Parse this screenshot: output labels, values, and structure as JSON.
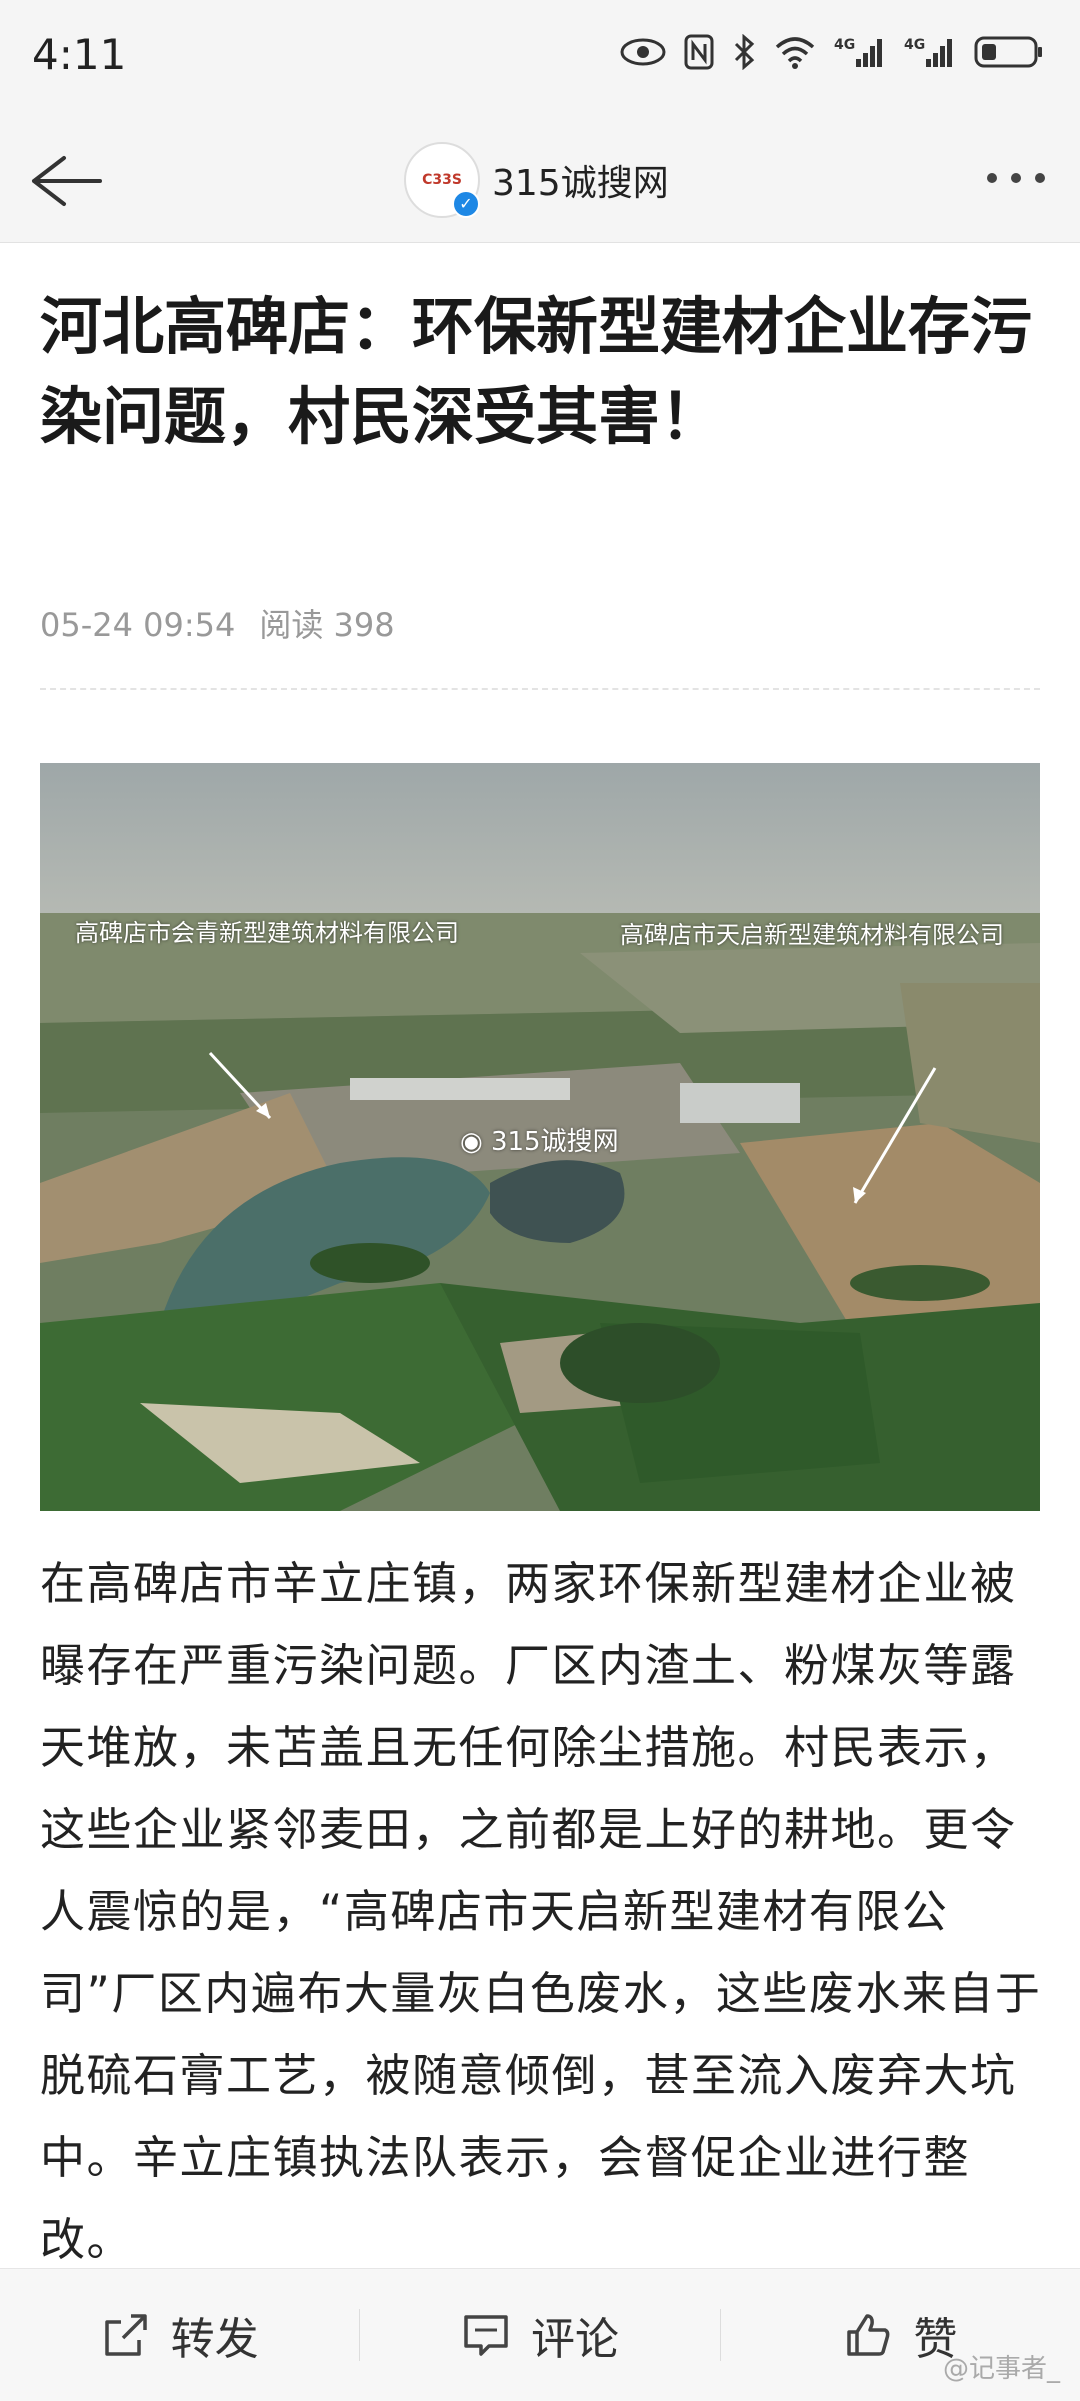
{
  "status_bar": {
    "time": "4:11"
  },
  "header": {
    "brand_logo_text": "C33S",
    "brand_name": "315诚搜网"
  },
  "article": {
    "title": "河北高碑店：环保新型建材企业存污染问题，村民深受其害！",
    "date": "05-24 09:54",
    "reads": "阅读 398",
    "photo": {
      "label_left": "高碑店市会青新型建筑材料有限公司",
      "label_right": "高碑店市天启新型建筑材料有限公司",
      "watermark": "315诚搜网"
    },
    "body": "在高碑店市辛立庄镇，两家环保新型建材企业被曝存在严重污染问题。厂区内渣土、粉煤灰等露天堆放，未苫盖且无任何除尘措施。村民表示，这些企业紧邻麦田，之前都是上好的耕地。更令人震惊的是，“高碑店市天启新型建材有限公司”厂区内遍布大量灰白色废水，这些废水来自于脱硫石膏工艺，被随意倾倒，甚至流入废弃大坑中。辛立庄镇执法队表示，会督促企业进行整改。"
  },
  "bottom_bar": {
    "share": "转发",
    "comment": "评论",
    "like": "赞",
    "watermark": "@记事者_"
  }
}
